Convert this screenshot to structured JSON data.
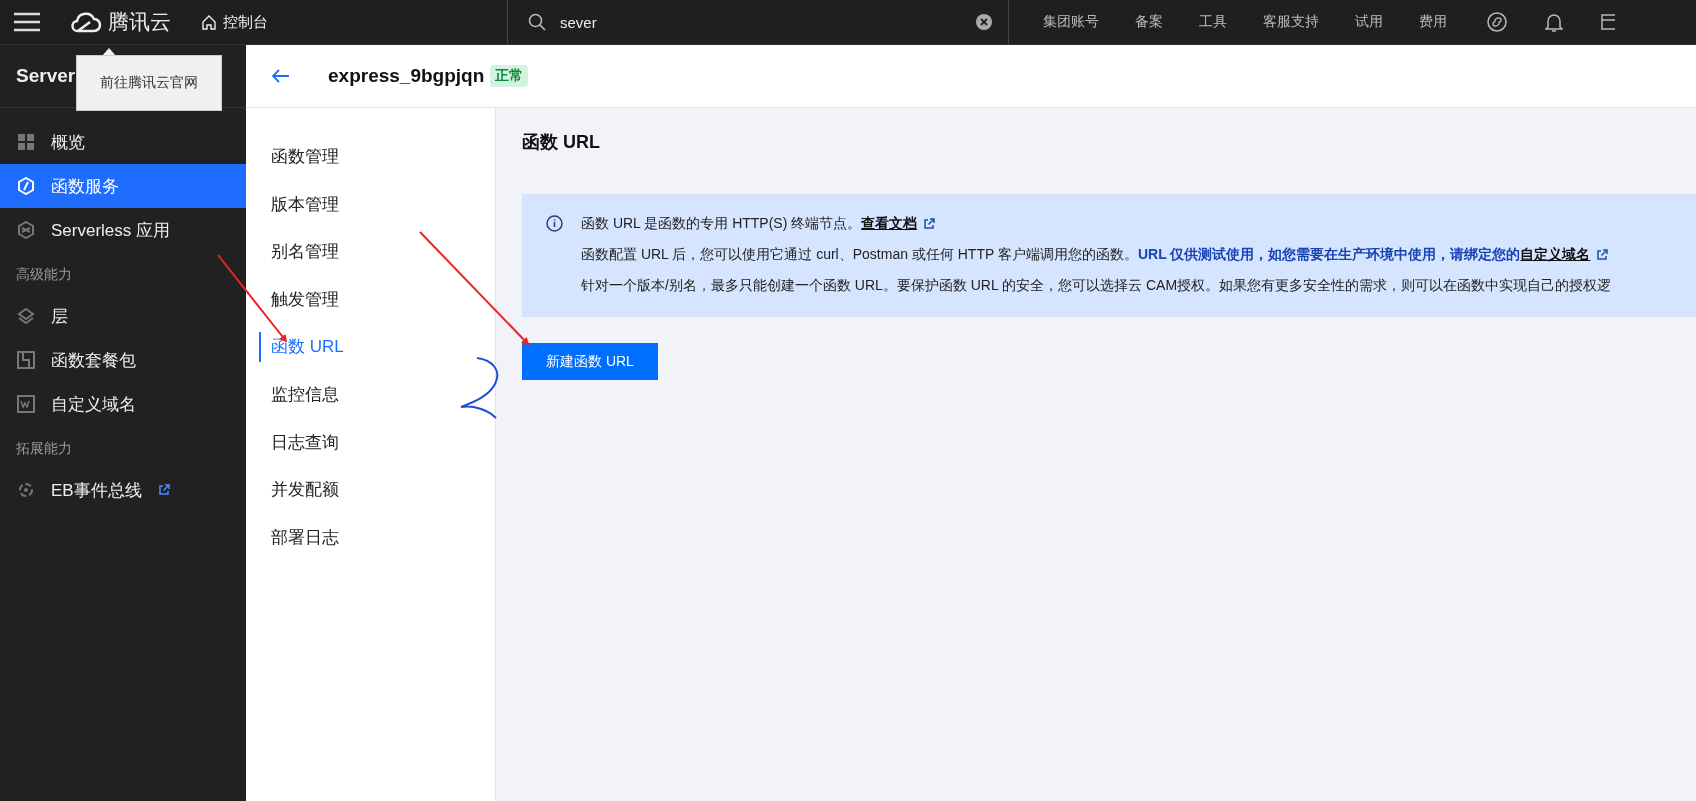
{
  "topbar": {
    "logo_text": "腾讯云",
    "console_label": "控制台",
    "search": {
      "value": "sever"
    },
    "links": [
      "集团账号",
      "备案",
      "工具",
      "客服支持",
      "试用",
      "费用"
    ]
  },
  "tooltip": {
    "text": "前往腾讯云官网"
  },
  "sidebar": {
    "title": "Server",
    "items": [
      {
        "kind": "item",
        "label": "概览",
        "selected": false,
        "external": false
      },
      {
        "kind": "item",
        "label": "函数服务",
        "selected": true,
        "external": false
      },
      {
        "kind": "item",
        "label": "Serverless 应用",
        "selected": false,
        "external": false
      },
      {
        "kind": "section",
        "label": "高级能力"
      },
      {
        "kind": "item",
        "label": "层",
        "selected": false,
        "external": false
      },
      {
        "kind": "item",
        "label": "函数套餐包",
        "selected": false,
        "external": false
      },
      {
        "kind": "item",
        "label": "自定义域名",
        "selected": false,
        "external": false
      },
      {
        "kind": "section",
        "label": "拓展能力"
      },
      {
        "kind": "item",
        "label": "EB事件总线",
        "selected": false,
        "external": true
      }
    ]
  },
  "header": {
    "title": "express_9bgpjqn",
    "status": "正常"
  },
  "subnav": [
    {
      "label": "函数管理",
      "selected": false
    },
    {
      "label": "版本管理",
      "selected": false
    },
    {
      "label": "别名管理",
      "selected": false
    },
    {
      "label": "触发管理",
      "selected": false
    },
    {
      "label": "函数 URL",
      "selected": true
    },
    {
      "label": "监控信息",
      "selected": false
    },
    {
      "label": "日志查询",
      "selected": false
    },
    {
      "label": "并发配额",
      "selected": false
    },
    {
      "label": "部署日志",
      "selected": false
    }
  ],
  "content": {
    "title": "函数 URL",
    "notice": [
      {
        "text": "函数 URL 是函数的专用 HTTP(S) 终端节点。",
        "link": "查看文档"
      },
      {
        "text": "函数配置 URL 后，您可以使用它通过 curl、Postman 或任何 HTTP 客户端调用您的函数。**URL 仅供测试使用，如您需要在生产环境中使用，请绑定您的**",
        "link": "自定义域名"
      },
      {
        "text": "针对一个版本/别名，最多只能创建一个函数 URL。要保护函数 URL 的安全，您可以选择云 CAM授权。如果您有更多安全性的需求，则可以在函数中实现自己的授权逻"
      }
    ],
    "button": "新建函数 URL"
  }
}
